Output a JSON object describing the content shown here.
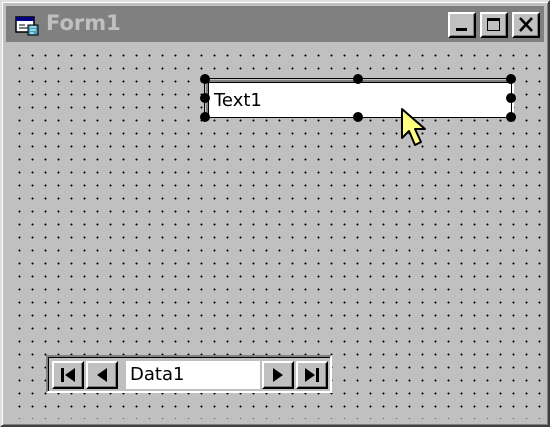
{
  "window": {
    "title": "Form1",
    "icon": "form-icon",
    "controls": [
      "minimize-icon",
      "maximize-icon",
      "close-icon"
    ]
  },
  "form": {
    "grid": "dotted",
    "textbox": {
      "text": "Text1",
      "selected": true
    },
    "data_control": {
      "caption": "Data1",
      "buttons": [
        "move-first-icon",
        "move-previous-icon",
        "move-next-icon",
        "move-last-icon"
      ]
    },
    "cursor": "arrow-cursor-icon"
  },
  "colors": {
    "face": "#c0c0c0",
    "title_inactive": "#808080",
    "title_text": "#c0c0c0",
    "cursor_fill": "#ffff80"
  }
}
